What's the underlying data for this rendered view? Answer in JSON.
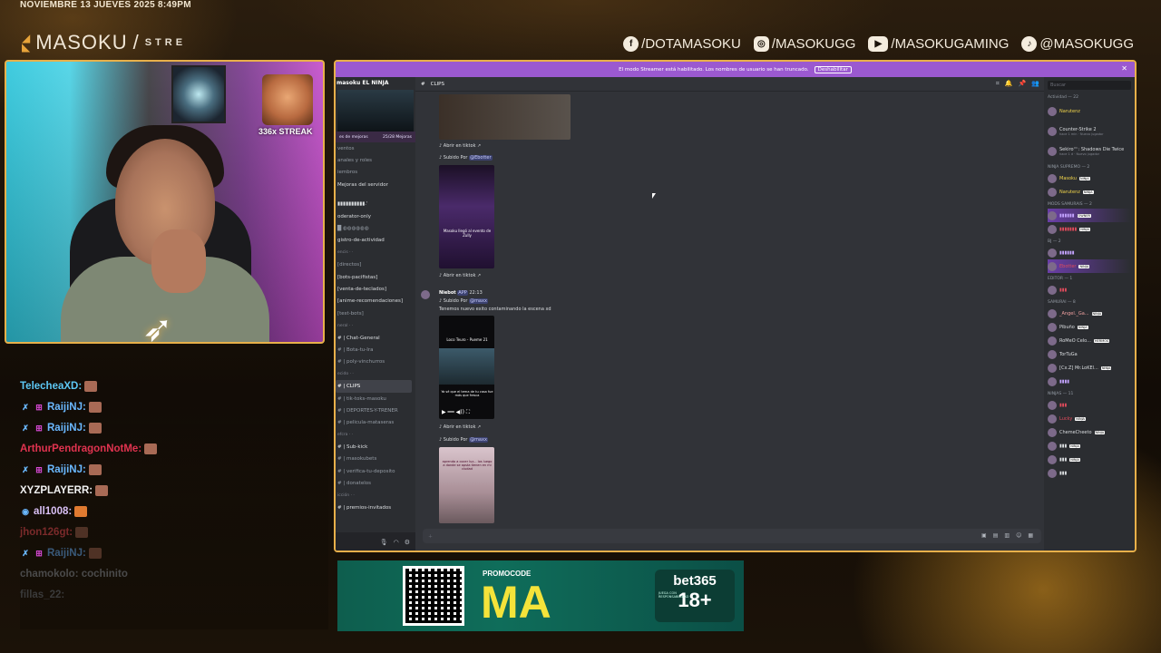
{
  "overlay": {
    "date": "NOVIEMBRE 13 JUEVES 2025 8:49PM",
    "brand_name": "MASOKU",
    "brand_sub": "STRE",
    "socials": [
      {
        "icon": "facebook-icon",
        "glyph": "f",
        "label": "/DOTAMASOKU"
      },
      {
        "icon": "instagram-icon",
        "glyph": "◎",
        "label": "/MASOKUGG"
      },
      {
        "icon": "youtube-icon",
        "glyph": "▶",
        "label": "/MASOKUGAMING"
      },
      {
        "icon": "tiktok-icon",
        "glyph": "♪",
        "label": "@MASOKUGG"
      }
    ],
    "accent": "#e8b04a"
  },
  "webcam": {
    "streak": "336x STREAK"
  },
  "chat": [
    {
      "user": "TelecheaXD:",
      "color": "#5dc8f5",
      "badges": []
    },
    {
      "user": "RaijiNJ:",
      "color": "#6ab8ff",
      "badges": [
        "✗",
        "⊞"
      ]
    },
    {
      "user": "RaijiNJ:",
      "color": "#6ab8ff",
      "badges": [
        "✗",
        "⊞"
      ]
    },
    {
      "user": "ArthurPendragonNotMe:",
      "color": "#e0334f",
      "badges": []
    },
    {
      "user": "RaijiNJ:",
      "color": "#6ab8ff",
      "badges": [
        "✗",
        "⊞"
      ]
    },
    {
      "user": "XYZPLAYERR:",
      "color": "#f2f2f2",
      "badges": []
    },
    {
      "user": "all1008:",
      "color": "#d9c0f5",
      "badges": [
        "◉"
      ]
    },
    {
      "user": "jhon126gt:",
      "color": "#7a2a2a",
      "badges": []
    },
    {
      "user": "RaijiNJ:",
      "color": "#3a5a7a",
      "badges": [
        "✗",
        "⊞"
      ]
    },
    {
      "user": "chamokolo: cochinito",
      "color": "#4a4a4a",
      "badges": []
    },
    {
      "user": "fillas_22:",
      "color": "#3a3a3a",
      "badges": []
    }
  ],
  "discord": {
    "banner_text": "El modo Streamer está habilitado. Los nombres de usuario se han truncado.",
    "banner_button": "Deshabilitar",
    "server_name": "masoku EL NINJA",
    "boost_left": "es de mejoras",
    "boost_right": "25/28 Mejoras",
    "channels": [
      {
        "label": "ventos",
        "type": "normal"
      },
      {
        "label": "anales y roles",
        "type": "normal"
      },
      {
        "label": "iembros",
        "type": "normal"
      },
      {
        "label": "Mejoras del servidor",
        "type": "bright"
      },
      {
        "label": "",
        "type": "spacer"
      },
      {
        "label": "▮▮▮▮▮▮▮▮▮▮.'",
        "type": "bright"
      },
      {
        "label": "oderator-only",
        "type": "bright"
      },
      {
        "label": "█ ◍◍◍◍◍◍",
        "type": "normal"
      },
      {
        "label": "gistro-de-actividad",
        "type": "bright"
      },
      {
        "label": "encis · ·",
        "type": "cat"
      },
      {
        "label": "[directos]",
        "type": "normal"
      },
      {
        "label": "[bots-pacifistas]",
        "type": "bright"
      },
      {
        "label": "[venta-de-teclados]",
        "type": "bright"
      },
      {
        "label": "[anime-recomendaciones]",
        "type": "bright"
      },
      {
        "label": "[test-bots]",
        "type": "normal"
      },
      {
        "label": "neral · ·",
        "type": "cat"
      },
      {
        "label": "# | Chat-General",
        "type": "bright"
      },
      {
        "label": "# | Bota-tu-Ira",
        "type": "normal"
      },
      {
        "label": "# | poly-vinchurros",
        "type": "normal"
      },
      {
        "label": "ecido · ·",
        "type": "cat"
      },
      {
        "label": "# | CLIPS",
        "type": "active"
      },
      {
        "label": "# | tik-toks-masoku",
        "type": "normal"
      },
      {
        "label": "# | DEPORTES-Y-TRENER",
        "type": "normal"
      },
      {
        "label": "# | pelicula-mataseras",
        "type": "normal"
      },
      {
        "label": "efcra · ·",
        "type": "cat"
      },
      {
        "label": "# | Sub-kick",
        "type": "bright"
      },
      {
        "label": "# | masokubets",
        "type": "normal"
      },
      {
        "label": "# | verifica-tu-deposito",
        "type": "normal"
      },
      {
        "label": "# | donatelos",
        "type": "normal"
      },
      {
        "label": "icción · ·",
        "type": "cat"
      },
      {
        "label": "# | premios-invitados",
        "type": "bright"
      }
    ],
    "channel_name": "CLIPS",
    "messages": {
      "open_tiktok": "Abrir en tiktok",
      "uploaded_by": "Subido Por",
      "mention1": "@Ebotter",
      "video1_caption": "Masoku llegó al evento de Zully",
      "author": "Niebot",
      "app_tag": "APP",
      "time": "22:13",
      "mention2": "@maxx",
      "text": "Tenemos nuevo exito contaminando la escena xd",
      "video2_title": "Loco Teuro - Pueme 21",
      "video2_caption": "Ya sé que el tema de tu casa fue más que fresca",
      "mention3": "@maxx",
      "video3_caption": "aprenda a cocer luz... los luego a donde se apsta tienen en mi ciudad"
    },
    "input_placeholder": "Enviar mensaje a # ▯ | clips",
    "members": {
      "search": "Buscar",
      "activity_header": "Actividad — 22",
      "activity": [
        {
          "name": "Narutenz",
          "detail": "",
          "color": "#f2d54b"
        },
        {
          "name": "Counter-Strike 2",
          "detail": "hace 1 min · Nuevo jugador",
          "color": "#dbdee1"
        },
        {
          "name": "Sekiro™: Shadows Die Twice",
          "detail": "hace 1 d · Nuevo jugador",
          "color": "#dbdee1"
        }
      ],
      "groups": [
        {
          "header": "NINJA SUPREMO — 2",
          "items": [
            {
              "name": "Masoku",
              "color": "#f2d54b",
              "tag": "NINJA"
            },
            {
              "name": "Narutenz",
              "color": "#f2d54b",
              "tag": "NINJA"
            }
          ]
        },
        {
          "header": "MODS SAMURAIS — 2",
          "items": [
            {
              "name": "▮▮▮▮▮▮",
              "color": "#c3a3ff",
              "tag": "OWNER"
            },
            {
              "name": "▮▮▮▮▮▮▮",
              "color": "#e04b5c",
              "tag": "NINJA"
            }
          ]
        },
        {
          "header": "BJ — 2",
          "items": [
            {
              "name": "▮▮▮▮▮▮",
              "color": "#c3a3ff",
              "tag": ""
            },
            {
              "name": "Ebotter",
              "color": "#e04b5c",
              "tag": "NINJA"
            }
          ]
        },
        {
          "header": "EDITOR — 1",
          "items": [
            {
              "name": "▮▮▮",
              "color": "#e04b5c",
              "tag": ""
            }
          ]
        },
        {
          "header": "SAMURAI — 8",
          "items": [
            {
              "name": "_Angel._Ga...",
              "color": "#f0a0a0",
              "tag": "NINJA"
            },
            {
              "name": "Pibuño",
              "color": "#dbdee1",
              "tag": "NINJA"
            },
            {
              "name": "RoMeO Celo...",
              "color": "#dbdee1",
              "tag": "HERMOS"
            },
            {
              "name": "TorTuGa",
              "color": "#dbdee1",
              "tag": ""
            },
            {
              "name": "[Cx.Z] Mr.LoKEl...",
              "color": "#dbdee1",
              "tag": "NINJA"
            },
            {
              "name": "▮▮▮▮",
              "color": "#c3a3ff",
              "tag": ""
            }
          ]
        },
        {
          "header": "NINJAS — 11",
          "items": [
            {
              "name": "▮▮▮",
              "color": "#e04b5c",
              "tag": ""
            },
            {
              "name": "Lucky",
              "color": "#e04b5c",
              "tag": "NINJA"
            },
            {
              "name": "ChemeCheeto",
              "color": "#dbdee1",
              "tag": "NINJA"
            },
            {
              "name": "▮▮▮",
              "color": "#dbdee1",
              "tag": "NINJA"
            },
            {
              "name": "▮▮▮",
              "color": "#dbdee1",
              "tag": "NINJA"
            },
            {
              "name": "▮▮▮",
              "color": "#dbdee1",
              "tag": ""
            }
          ]
        }
      ]
    }
  },
  "ad": {
    "promo_label": "PROMOCODE",
    "code": "MA",
    "brand": "bet365",
    "age": "18+",
    "fine_print": "JUEGA CON RESPONSABILIDAD"
  }
}
